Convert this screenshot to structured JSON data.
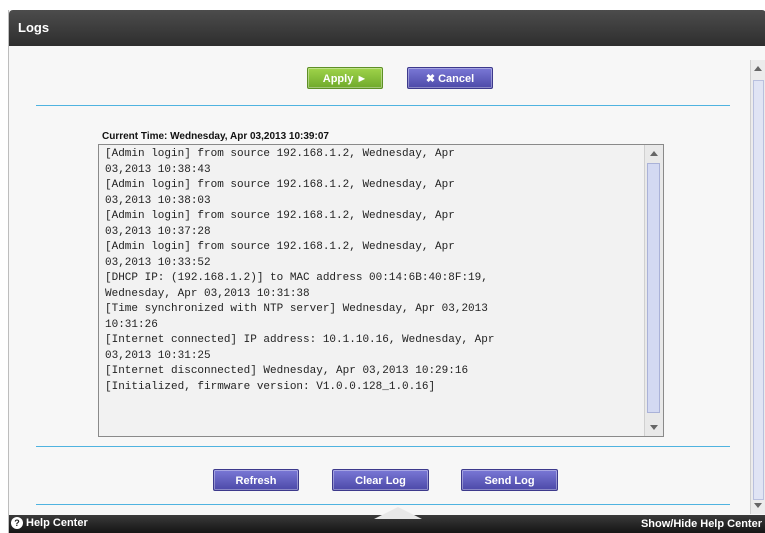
{
  "window": {
    "title": "Logs"
  },
  "top_buttons": {
    "apply": "Apply ►",
    "cancel": "✖ Cancel"
  },
  "current_time": "Current Time: Wednesday, Apr 03,2013 10:39:07",
  "log_entries": [
    "[Admin login] from source 192.168.1.2, Wednesday, Apr",
    "03,2013 10:38:43",
    "[Admin login] from source 192.168.1.2, Wednesday, Apr",
    "03,2013 10:38:03",
    "[Admin login] from source 192.168.1.2, Wednesday, Apr",
    "03,2013 10:37:28",
    "[Admin login] from source 192.168.1.2, Wednesday, Apr",
    "03,2013 10:33:52",
    "[DHCP IP: (192.168.1.2)] to MAC address 00:14:6B:40:8F:19,",
    "Wednesday, Apr 03,2013 10:31:38",
    "[Time synchronized with NTP server] Wednesday, Apr 03,2013",
    "10:31:26",
    "[Internet connected] IP address: 10.1.10.16, Wednesday, Apr",
    "03,2013 10:31:25",
    "[Internet disconnected] Wednesday, Apr 03,2013 10:29:16",
    "[Initialized, firmware version: V1.0.0.128_1.0.16]"
  ],
  "bottom_buttons": {
    "refresh": "Refresh",
    "clear_log": "Clear Log",
    "send_log": "Send Log"
  },
  "footer": {
    "help_center": "Help Center",
    "show_hide": "Show/Hide Help Center"
  },
  "colors": {
    "accent_green": "#7fbf33",
    "accent_purple": "#5e5bc2",
    "divider_blue": "#4fb3e0"
  }
}
